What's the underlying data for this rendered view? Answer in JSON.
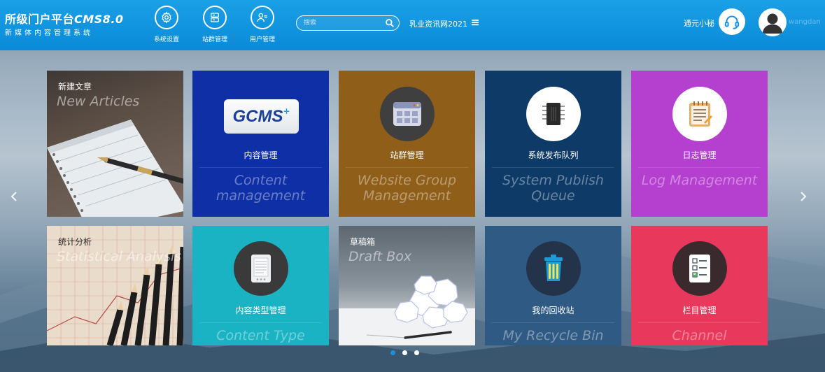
{
  "header": {
    "title_cn": "所级门户平台",
    "title_cms": "CMS8.0",
    "subtitle": "新媒体内容管理系统",
    "nav": [
      {
        "label": "系统设置",
        "icon": "gear-icon"
      },
      {
        "label": "站群管理",
        "icon": "server-icon"
      },
      {
        "label": "用户管理",
        "icon": "users-icon"
      }
    ],
    "search_placeholder": "搜索",
    "site_name": "乳业资讯网2021",
    "assistant_label": "通元小秘",
    "username": "wangdan"
  },
  "tiles": [
    {
      "cn": "新建文章",
      "en": "New Articles",
      "color": "#5b4e45"
    },
    {
      "cn": "内容管理",
      "en": "Content management",
      "color": "#0f2fa6",
      "logo": "GCMS"
    },
    {
      "cn": "站群管理",
      "en": "Website Group Management",
      "color": "#8f5f1a"
    },
    {
      "cn": "系统发布队列",
      "en": "System Publish Queue",
      "color": "#0d3a66"
    },
    {
      "cn": "日志管理",
      "en": "Log Management",
      "color": "#b540cf"
    },
    {
      "cn": "统计分析",
      "en": "Statistical Analysis",
      "color": "#e8d7c4"
    },
    {
      "cn": "内容类型管理",
      "en": "Content Type Management",
      "color": "#19b3c4"
    },
    {
      "cn": "草稿箱",
      "en": "Draft Box",
      "color": "#7f8b94"
    },
    {
      "cn": "我的回收站",
      "en": "My Recycle Bin",
      "color": "#2f5a84"
    },
    {
      "cn": "栏目管理",
      "en": "Channel Management",
      "color": "#e8395c"
    }
  ],
  "carousel": {
    "dots": 3,
    "active": 0
  }
}
